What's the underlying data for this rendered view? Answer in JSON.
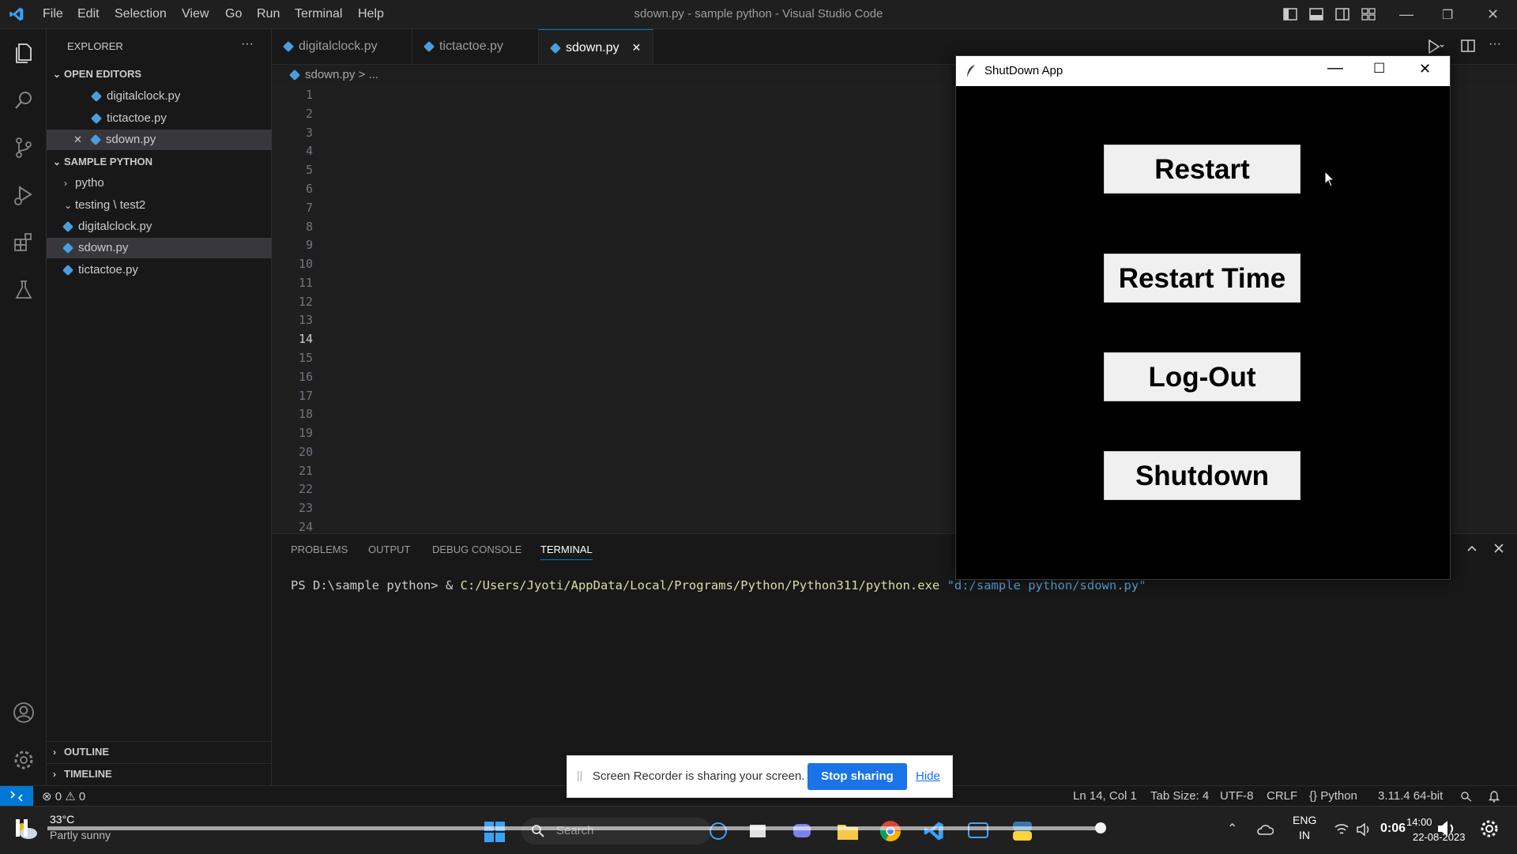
{
  "window": {
    "title": "sdown.py - sample python - Visual Studio Code",
    "menu": [
      "File",
      "Edit",
      "Selection",
      "View",
      "Go",
      "Run",
      "Terminal",
      "Help"
    ]
  },
  "sidebar": {
    "header": "EXPLORER",
    "more": "···",
    "open_editors_title": "OPEN EDITORS",
    "open_editors": [
      "digitalclock.py",
      "tictactoe.py",
      "sdown.py"
    ],
    "close_mark": "✕",
    "folder_title": "SAMPLE PYTHON",
    "folders": [
      "pytho",
      "testing \\ test2"
    ],
    "files": [
      "digitalclock.py",
      "sdown.py",
      "tictactoe.py"
    ],
    "outline": "OUTLINE",
    "timeline": "TIMELINE"
  },
  "tabs": [
    {
      "label": "digitalclock.py"
    },
    {
      "label": "tictactoe.py"
    },
    {
      "label": "sdown.py",
      "close": "✕"
    }
  ],
  "breadcrumb": "sdown.py > ...",
  "code_lines": [
    "1",
    "2",
    "3",
    "4",
    "5",
    "6",
    "7",
    "8",
    "9",
    "10",
    "11",
    "12",
    "13",
    "14",
    "15",
    "16",
    "17",
    "18",
    "19",
    "20",
    "21",
    "22",
    "23",
    "24"
  ],
  "panel": {
    "tabs": [
      "PROBLEMS",
      "OUTPUT",
      "DEBUG CONSOLE",
      "TERMINAL"
    ],
    "prompt": "PS D:\\sample python> & ",
    "exe": "C:/Users/Jyoti/AppData/Local/Programs/Python/Python311/python.exe",
    "arg": "\"d:/sample python/sdown.py\""
  },
  "statusbar": {
    "errors": "0",
    "warnings": "0",
    "position": "Ln 14, Col 1",
    "tab_size": "Tab Size: 4",
    "encoding": "UTF-8",
    "eol": "CRLF",
    "language": "Python",
    "interpreter": "3.11.4 64-bit"
  },
  "tk_app": {
    "title": "ShutDown App",
    "buttons": [
      "Restart",
      "Restart Time",
      "Log-Out",
      "Shutdown"
    ]
  },
  "share_bar": {
    "text": "Screen Recorder is sharing your screen.",
    "stop": "Stop sharing",
    "hide": "Hide"
  },
  "taskbar": {
    "temp": "33°C",
    "weather": "Partly sunny",
    "search": "Search",
    "lang1": "ENG",
    "lang2": "IN",
    "video_time": "0:06",
    "clock": "14:00",
    "date": "22-08-2023"
  },
  "colors": {
    "accent": "#0078d4",
    "editor_bg": "#1f1f1f",
    "tk_bg": "#000000"
  }
}
